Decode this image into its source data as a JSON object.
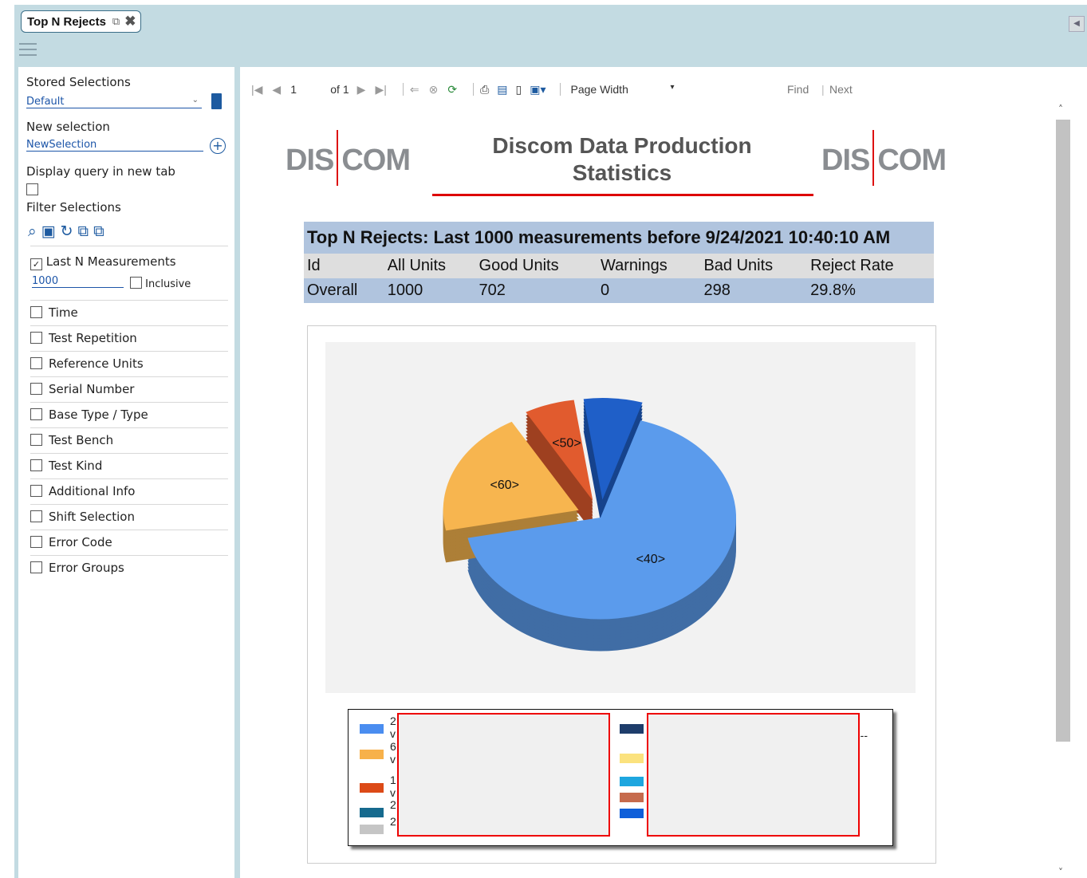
{
  "tab": {
    "title": "Top N Rejects"
  },
  "sidebar": {
    "stored_label": "Stored Selections",
    "stored_value": "Default",
    "new_label": "New selection",
    "new_value": "NewSelection",
    "display_label": "Display query in new tab",
    "filter_label": "Filter Selections",
    "lastn_label": "Last N Measurements",
    "lastn_value": "1000",
    "inclusive_label": "Inclusive",
    "filters": [
      "Time",
      "Test Repetition",
      "Reference Units",
      "Serial Number",
      "Base Type / Type",
      "Test Bench",
      "Test Kind",
      "Additional Info",
      "Shift Selection",
      "Error Code",
      "Error Groups"
    ]
  },
  "toolbar": {
    "page_current": "1",
    "page_of": "of",
    "page_total": "1",
    "zoom": "Page Width",
    "find": "Find",
    "next": "Next"
  },
  "report": {
    "logo": "DISCOM",
    "title_line1": "Discom Data Production",
    "title_line2": "Statistics",
    "table_title": "Top N Rejects: Last 1000 measurements before 9/24/2021 10:40:10 AM",
    "columns": [
      "Id",
      "All Units",
      "Good Units",
      "Warnings",
      "Bad Units",
      "Reject Rate"
    ],
    "row": [
      "Overall",
      "1000",
      "702",
      "0",
      "298",
      "29.8%"
    ]
  },
  "chart_data": {
    "type": "pie",
    "slices": [
      {
        "label": "<40>",
        "value": 67,
        "color": "#5b9bec"
      },
      {
        "label": "<60>",
        "value": 20,
        "color": "#f7b54f"
      },
      {
        "label": "<50>",
        "value": 6,
        "color": "#e15b2e"
      },
      {
        "label": "",
        "value": 7,
        "color": "#1f5fc8"
      }
    ],
    "legend_left": [
      {
        "color": "#4a8df0",
        "text": "2"
      },
      {
        "color": "#f7b14a",
        "text": "6"
      },
      {
        "color": "#dc4a17",
        "text": "1"
      },
      {
        "color": "#166a8e",
        "text": "2"
      },
      {
        "color": "#c5c5c5",
        "text": "2"
      }
    ],
    "legend_left_sub": [
      "v",
      "v",
      "v"
    ],
    "legend_right_colors": [
      "#1e3d6b",
      "#fbe27e",
      "#1ea6df",
      "#c66b4d",
      "#0f5fd9"
    ],
    "legend_right_tail": "---"
  },
  "colors": {
    "accent": "#c3dbe2",
    "title_rule": "#dd0000",
    "table_band": "#b0c4de"
  }
}
